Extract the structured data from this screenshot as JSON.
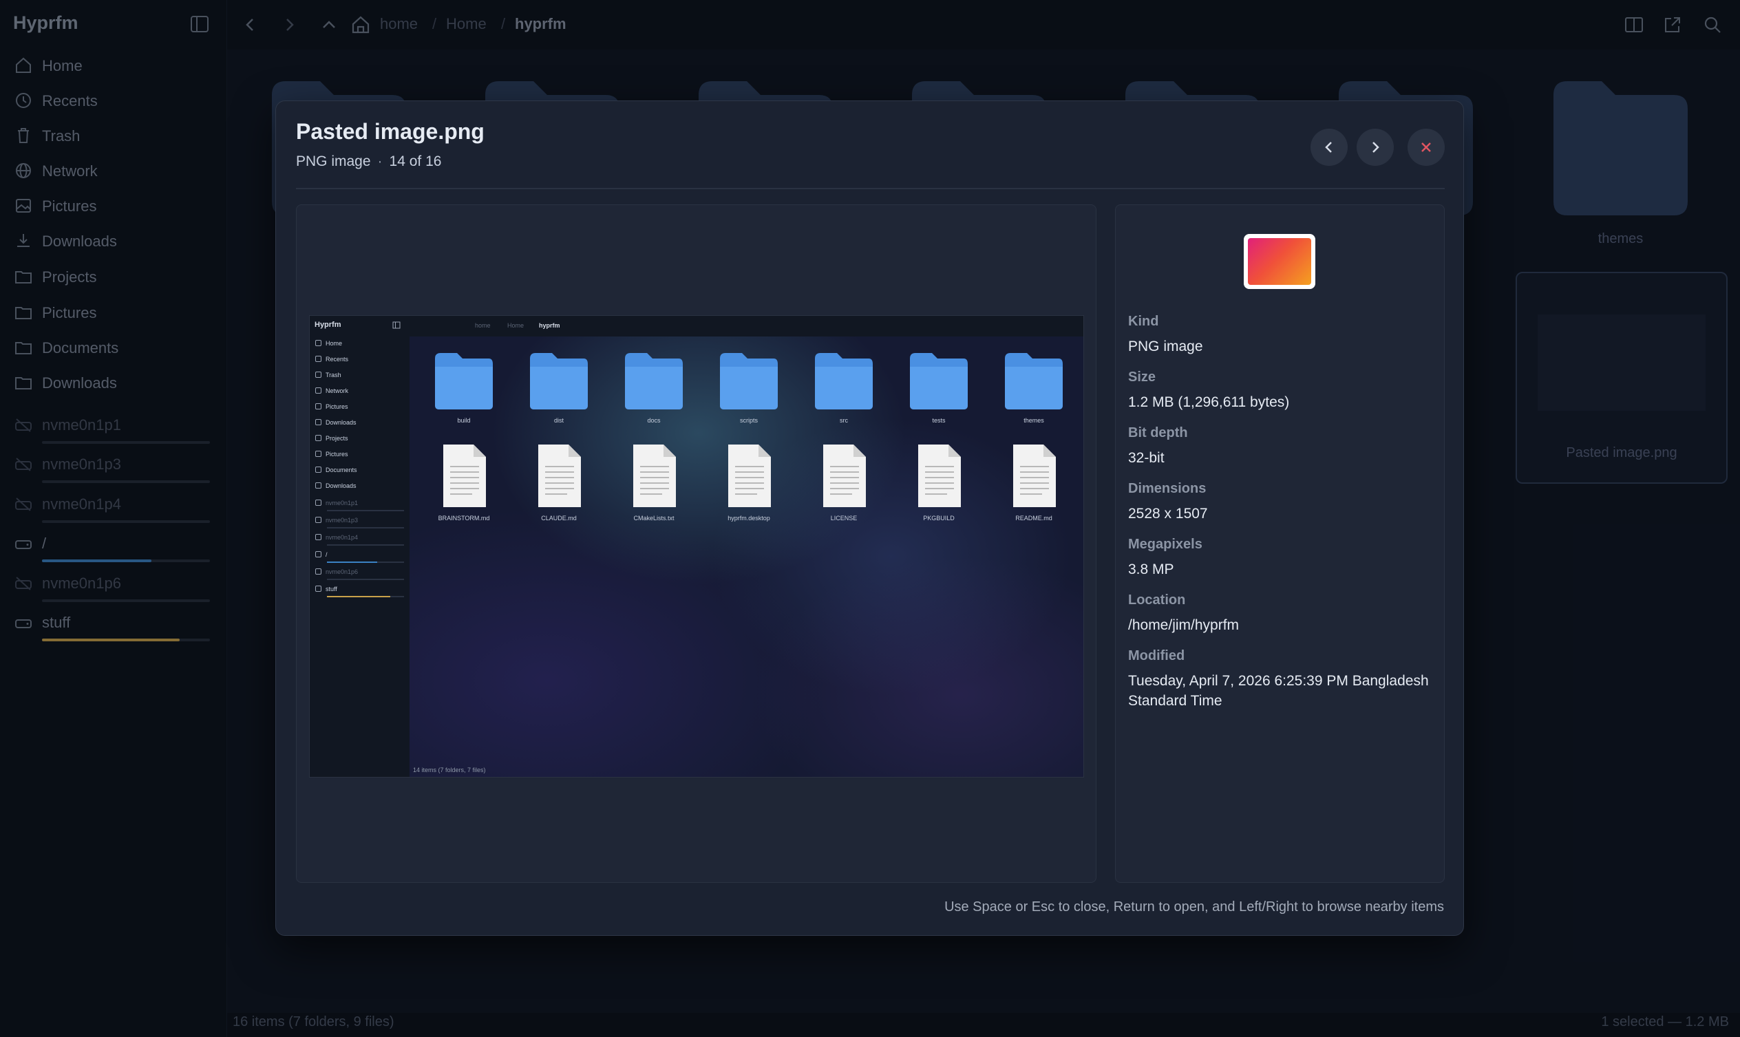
{
  "app": {
    "title": "Hyprfm"
  },
  "sidebar": {
    "items": [
      {
        "label": "Home",
        "icon": "home-icon"
      },
      {
        "label": "Recents",
        "icon": "clock-icon"
      },
      {
        "label": "Trash",
        "icon": "trash-icon"
      },
      {
        "label": "Network",
        "icon": "globe-icon"
      },
      {
        "label": "Pictures",
        "icon": "image-icon"
      },
      {
        "label": "Downloads",
        "icon": "download-icon"
      },
      {
        "label": "Projects",
        "icon": "folder-icon"
      },
      {
        "label": "Pictures",
        "icon": "folder-icon"
      },
      {
        "label": "Documents",
        "icon": "folder-icon"
      },
      {
        "label": "Downloads",
        "icon": "folder-icon"
      }
    ],
    "drives": [
      {
        "label": "nvme0n1p1",
        "icon": "drive-unmounted-icon",
        "mounted": false
      },
      {
        "label": "nvme0n1p3",
        "icon": "drive-unmounted-icon",
        "mounted": false
      },
      {
        "label": "nvme0n1p4",
        "icon": "drive-unmounted-icon",
        "mounted": false
      },
      {
        "label": "/",
        "icon": "drive-icon",
        "mounted": true,
        "usage": 0.65,
        "color": "#3b82c4"
      },
      {
        "label": "nvme0n1p6",
        "icon": "drive-unmounted-icon",
        "mounted": false
      },
      {
        "label": "stuff",
        "icon": "drive-icon",
        "mounted": true,
        "usage": 0.82,
        "color": "#c9a24a"
      }
    ]
  },
  "header": {
    "breadcrumb": [
      "home",
      "Home",
      "hyprfm"
    ],
    "separator": "/"
  },
  "background": {
    "visible_labels": [
      "themes",
      "Pasted image.png"
    ]
  },
  "status": {
    "left": "16 items (7 folders, 9 files)",
    "right": "1 selected — 1.2 MB"
  },
  "preview": {
    "title": "Pasted image.png",
    "kind": "PNG image",
    "position": "14 of 16",
    "hint": "Use Space or Esc to close, Return to open, and Left/Right to browse nearby items",
    "details": [
      {
        "label": "Kind",
        "value": "PNG image"
      },
      {
        "label": "Size",
        "value": "1.2 MB (1,296,611 bytes)"
      },
      {
        "label": "Bit depth",
        "value": "32-bit"
      },
      {
        "label": "Dimensions",
        "value": "2528 x 1507"
      },
      {
        "label": "Megapixels",
        "value": "3.8 MP"
      },
      {
        "label": "Location",
        "value": "/home/jim/hyprfm"
      },
      {
        "label": "Modified",
        "value": "Tuesday, April 7, 2026 6:25:39 PM Bangladesh Standard Time"
      }
    ]
  },
  "thumbnail": {
    "title": "Hyprfm",
    "breadcrumb": [
      "home",
      "Home",
      "hyprfm"
    ],
    "sidebar": [
      "Home",
      "Recents",
      "Trash",
      "Network",
      "Pictures",
      "Downloads",
      "Projects",
      "Pictures",
      "Documents",
      "Downloads"
    ],
    "drives": [
      "nvme0n1p1",
      "nvme0n1p3",
      "nvme0n1p4",
      "/",
      "nvme0n1p6",
      "stuff"
    ],
    "folders": [
      "build",
      "dist",
      "docs",
      "scripts",
      "src",
      "tests",
      "themes"
    ],
    "files": [
      "BRAINSTORM.md",
      "CLAUDE.md",
      "CMakeLists.txt",
      "hyprfm.desktop",
      "LICENSE",
      "PKGBUILD",
      "README.md"
    ],
    "status": "14 items (7 folders, 7 files)"
  },
  "colors": {
    "accent": "#4a90e2",
    "close": "#e05561",
    "folder": "#4a90e2"
  }
}
